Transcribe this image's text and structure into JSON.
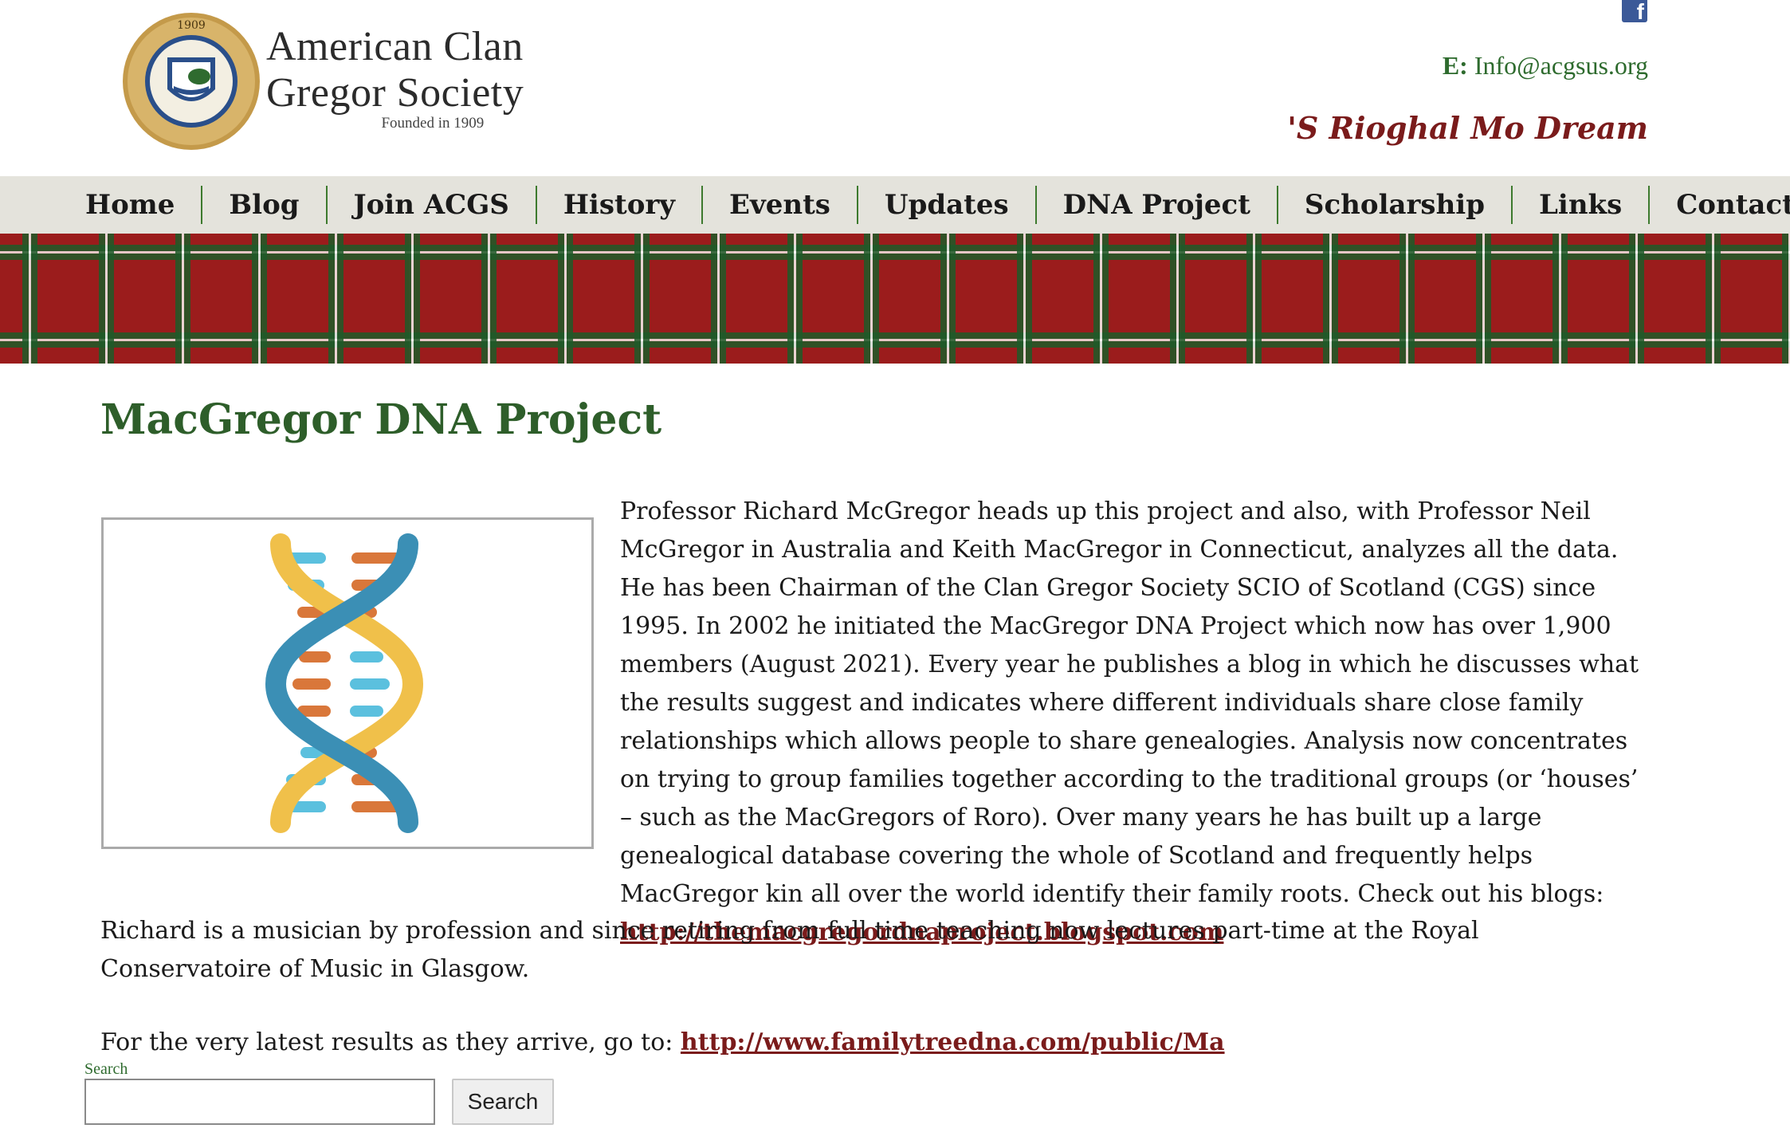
{
  "header": {
    "logo_line1": "American Clan",
    "logo_line2": "Gregor Society",
    "logo_founded": "Founded in 1909",
    "logo_seal_year": "1909",
    "email_label": "E:",
    "email": "Info@acgsus.org",
    "motto": "'S Rioghal Mo Dream",
    "social_icon": "facebook-icon"
  },
  "nav": {
    "items": [
      "Home",
      "Blog",
      "Join ACGS",
      "History",
      "Events",
      "Updates",
      "DNA Project",
      "Scholarship",
      "Links",
      "Contacts"
    ]
  },
  "main": {
    "title": "MacGregor DNA Project",
    "intro_text": "Professor Richard McGregor heads up this project and also, with Professor Neil McGregor in Australia and Keith MacGregor in Connecticut, analyzes all the data. He has been Chairman of the Clan Gregor Society SCIO of Scotland (CGS) since 1995. In 2002 he initiated the MacGregor DNA Project which now has over 1,900 members (August 2021). Every year he publishes a blog in which he discusses what the results suggest and indicates where different individuals share close family relationships which allows people to share genealogies. Analysis now concentrates on trying to group families together according to the traditional groups (or ‘houses’ –  such as the MacGregors of Roro). Over many years he has built up a large genealogical database covering the whole of Scotland and frequently helps MacGregor kin all over the world identify their family roots. Check out his blogs: ",
    "blog_link": "http://themacgregordnaproject.blogspot.com",
    "para2": "Richard is a musician by profession and since retiring from full time teaching now lectures part-time at the Royal Conservatoire of Music in Glasgow.",
    "para3_text": "For the very latest results as they arrive, go to: ",
    "results_link": "http://www.familytreedna.com/public/Ma",
    "image_icon": "dna-helix-icon"
  },
  "search": {
    "label": "Search",
    "value": "",
    "button": "Search"
  },
  "colors": {
    "green": "#2e5e2a",
    "dark_red": "#7a1b1b",
    "nav_bg": "#e4e3dc",
    "tartan_red": "#9b1c1c"
  }
}
